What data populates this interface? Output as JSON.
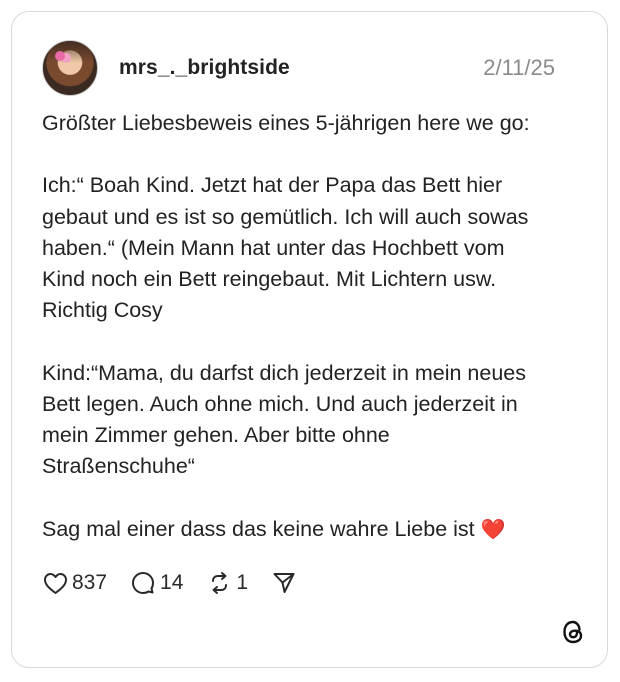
{
  "post": {
    "username": "mrs_._brightside",
    "date": "2/11/25",
    "paragraphs": [
      "Größter Liebesbeweis eines 5-jährigen here we go:",
      "Ich:“ Boah Kind. Jetzt hat der Papa das Bett hier\ngebaut und es ist so gemütlich. Ich will auch sowas\nhaben.“ (Mein Mann hat unter das Hochbett vom\nKind noch ein Bett reingebaut. Mit Lichtern usw.\nRichtig Cosy",
      "Kind:“Mama, du darfst dich jederzeit in mein neues\nBett legen. Auch ohne mich. Und auch jederzeit in\nmein Zimmer gehen. Aber bitte ohne\nStraßenschuhe“",
      "Sag mal einer dass das keine wahre Liebe ist"
    ],
    "heart_emoji": "❤️",
    "stats": {
      "likes": "837",
      "replies": "14",
      "reposts": "1"
    }
  },
  "icons": {
    "avatar": "profile-photo",
    "like": "heart-outline-icon",
    "reply": "speech-bubble-icon",
    "repost": "repost-arrows-icon",
    "share": "send-paper-plane-icon",
    "brand": "threads-logo-icon"
  },
  "colors": {
    "text": "#222222",
    "muted": "#8b8b8b",
    "border": "#d9d9d9",
    "heart": "#e22121"
  }
}
